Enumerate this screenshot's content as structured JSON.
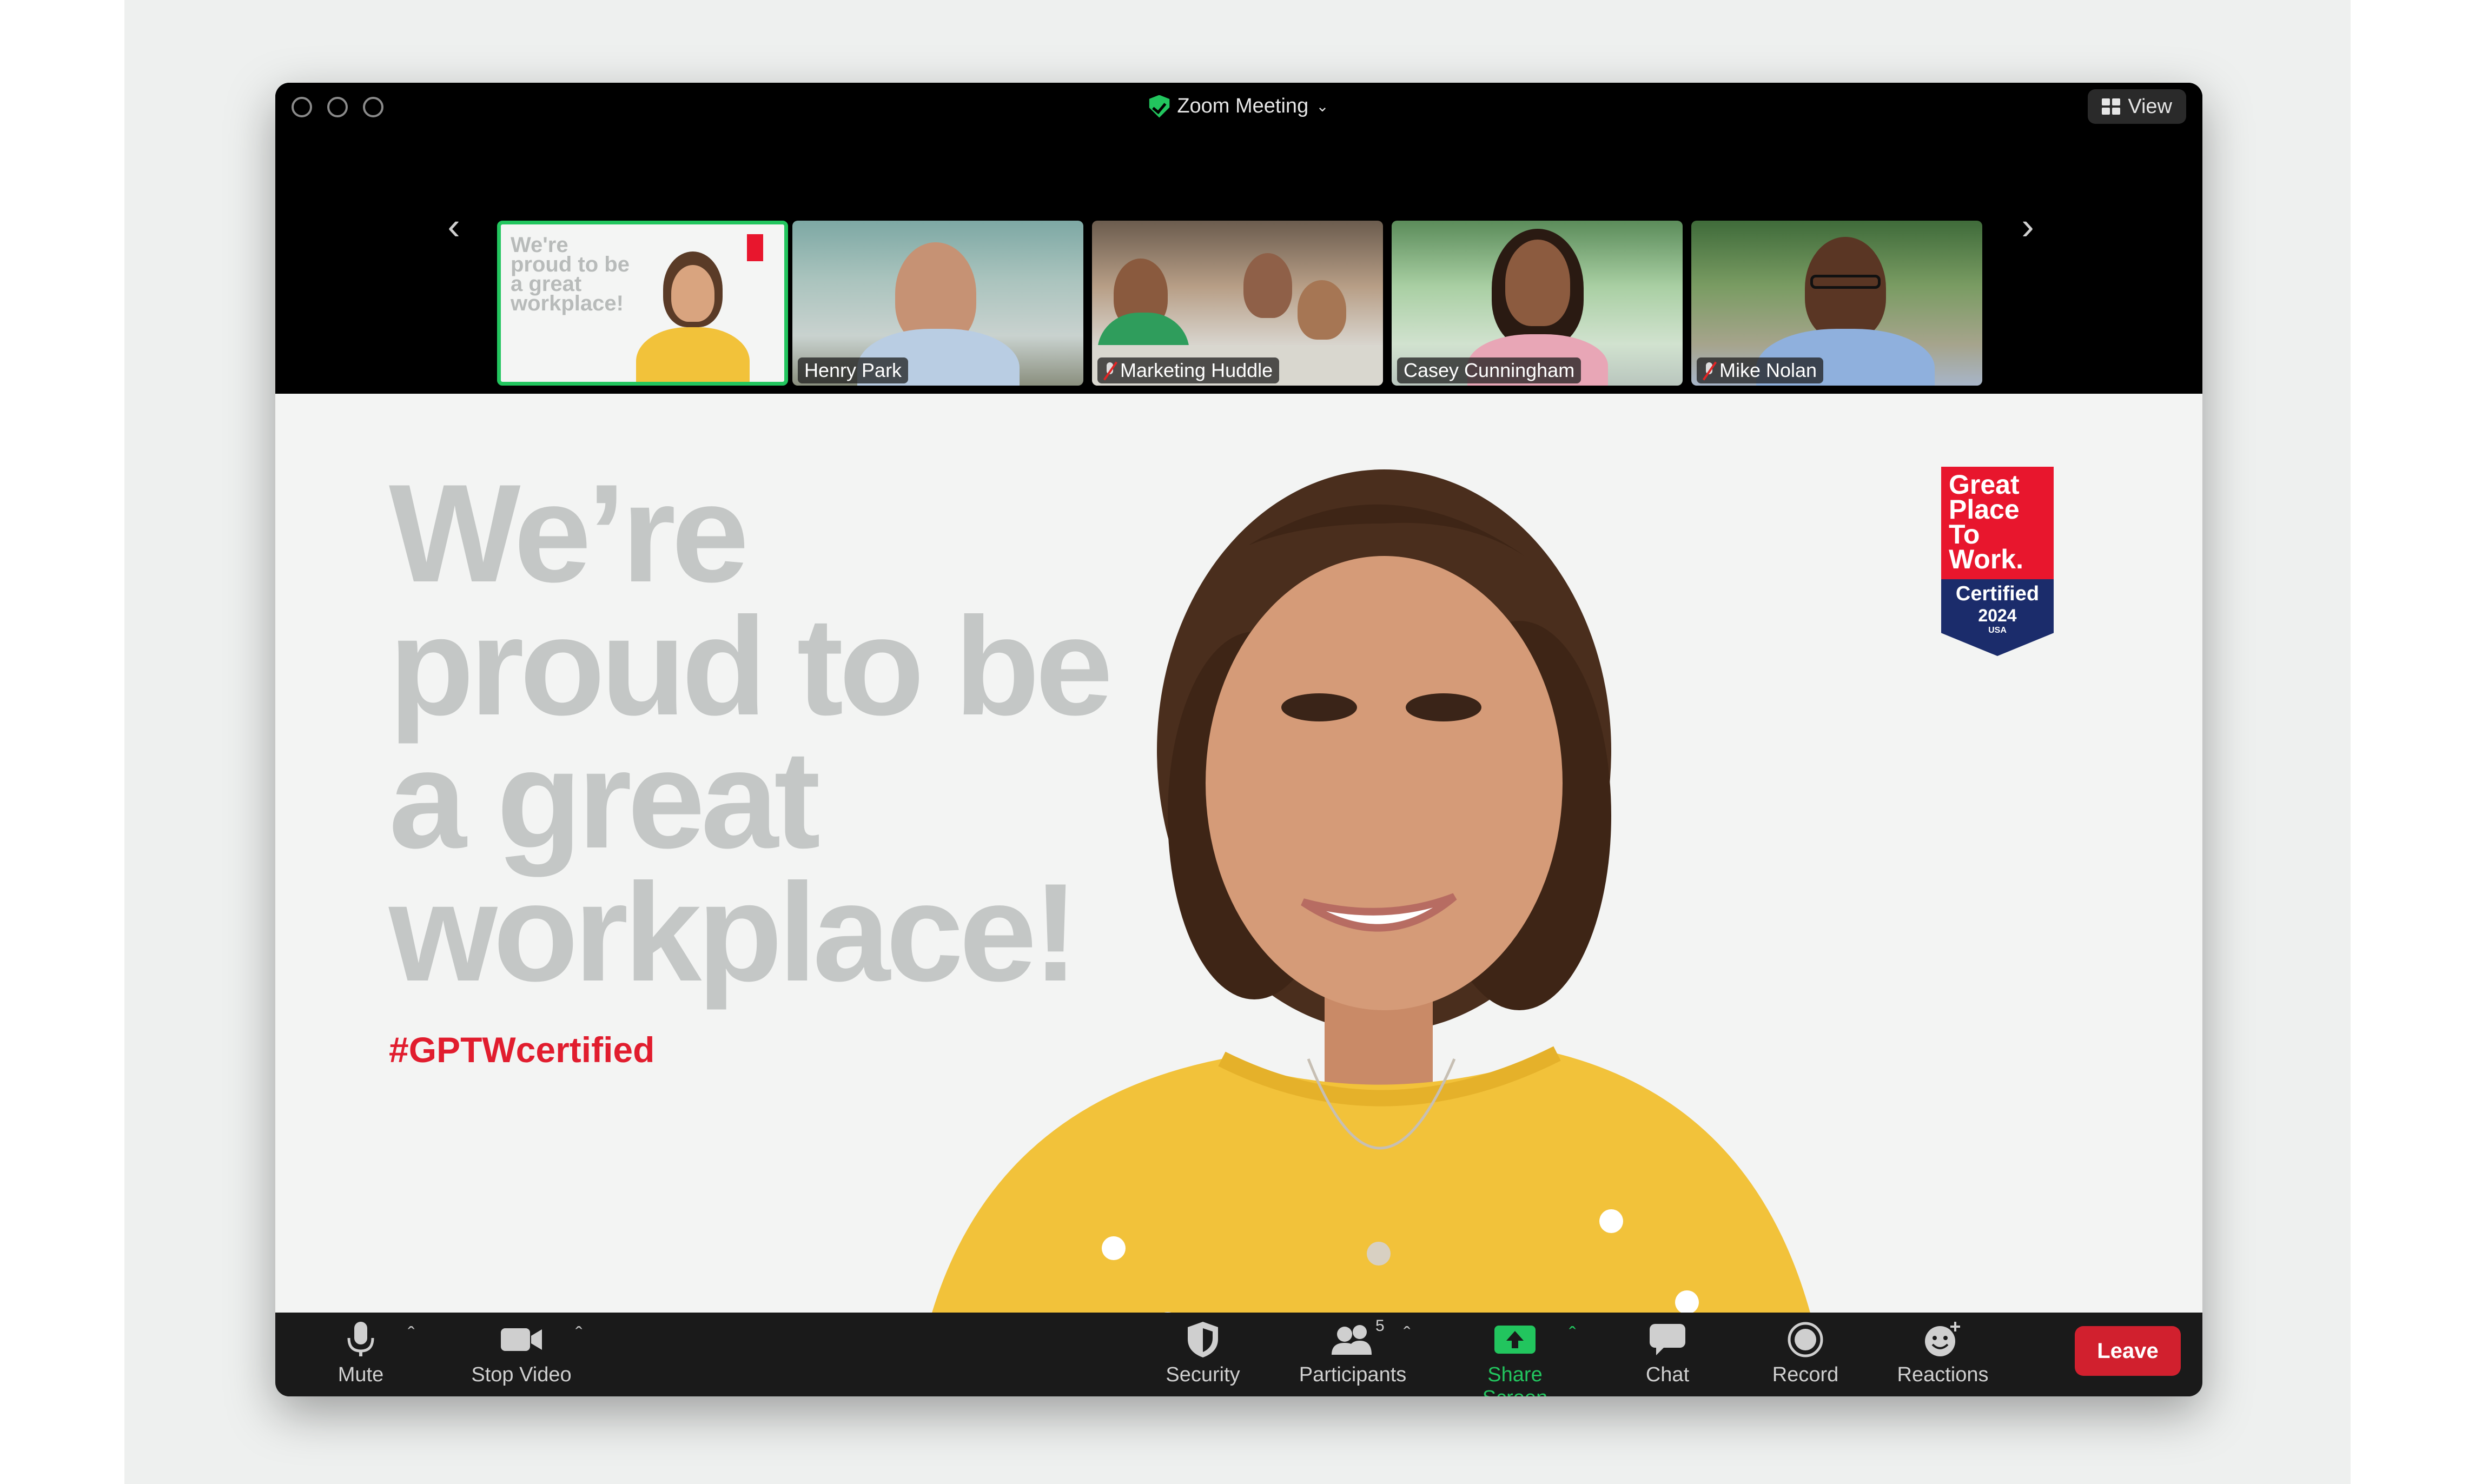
{
  "window": {
    "title": "Zoom Meeting",
    "view_label": "View"
  },
  "thumbnails": [
    {
      "name": "",
      "active": true,
      "muted": false,
      "slide_text": "We're proud to be a great workplace!"
    },
    {
      "name": "Henry Park",
      "active": false,
      "muted": false
    },
    {
      "name": "Marketing Huddle",
      "active": false,
      "muted": true
    },
    {
      "name": "Casey Cunningham",
      "active": false,
      "muted": false
    },
    {
      "name": "Mike Nolan",
      "active": false,
      "muted": true
    }
  ],
  "slide": {
    "headline": "We’re\nproud to be\na great\nworkplace!",
    "hashtag": "#GPTWcertified",
    "badge": {
      "top": "Great Place To Work.",
      "certified": "Certified",
      "year": "2024",
      "country": "USA"
    }
  },
  "toolbar": {
    "mute_label": "Mute",
    "stop_video_label": "Stop Video",
    "security_label": "Security",
    "participants_label": "Participants",
    "participants_count": "5",
    "share_screen_label": "Share Screen",
    "chat_label": "Chat",
    "record_label": "Record",
    "reactions_label": "Reactions",
    "leave_label": "Leave"
  },
  "colors": {
    "accent_green": "#22c55e",
    "leave_red": "#d1202e",
    "hashtag_red": "#e11d2e",
    "badge_navy": "#1b2c6b"
  }
}
